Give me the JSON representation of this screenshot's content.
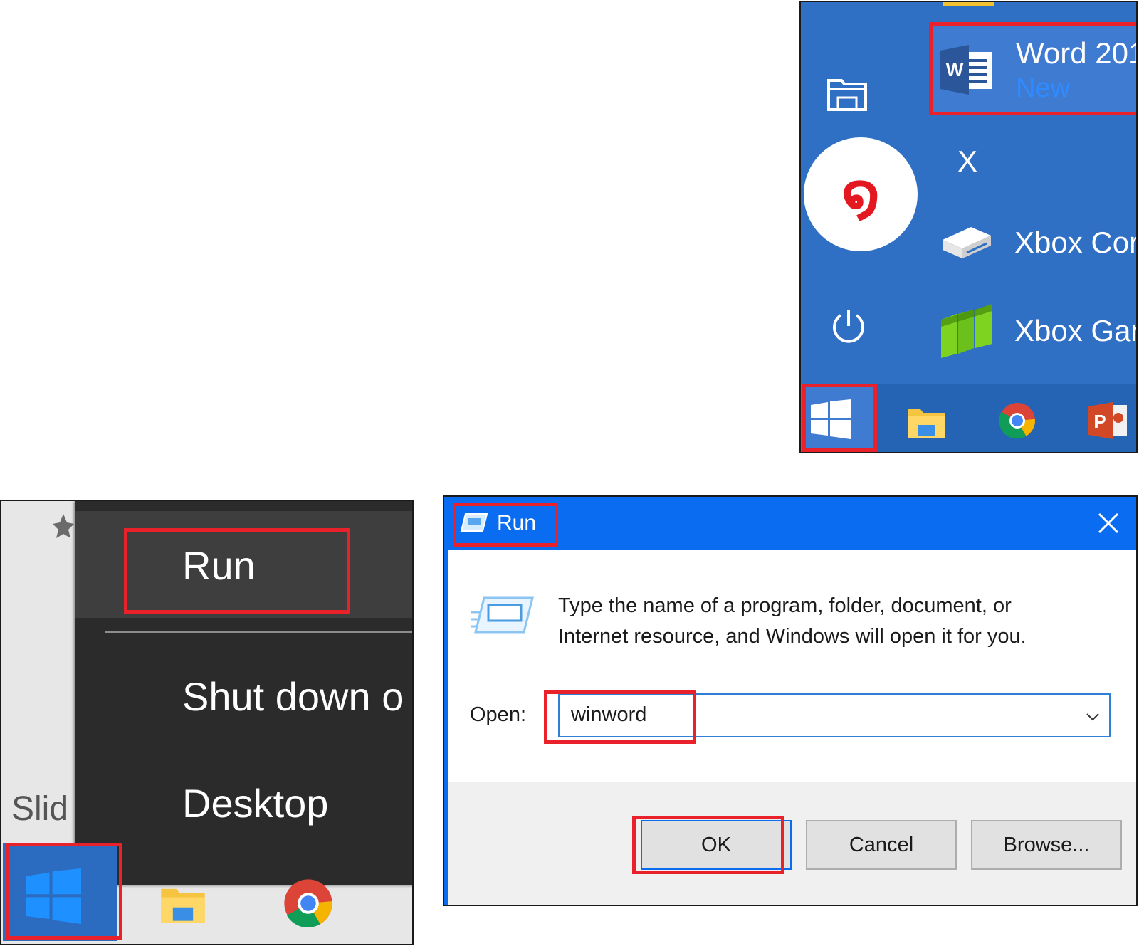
{
  "start_menu": {
    "apps": [
      {
        "label": "Word 201",
        "badge": "New",
        "icon": "word-icon"
      },
      {
        "label": "X",
        "icon": "none"
      },
      {
        "label": "Xbox Cor",
        "icon": "xbox-console-icon"
      },
      {
        "label": "Xbox Gan",
        "icon": "xbox-game-bar-icon"
      }
    ],
    "left_rail_icons": [
      "file-explorer-icon",
      "power-icon"
    ],
    "step_number": "໑",
    "taskbar_icons": [
      "windows-start-icon",
      "file-explorer-icon",
      "chrome-icon",
      "powerpoint-icon"
    ],
    "colors": {
      "menu_bg": "#2f6fc4",
      "highlight": "#e8212b"
    }
  },
  "context_menu": {
    "items": [
      {
        "label": "Run"
      },
      {
        "label": "Shut down o"
      },
      {
        "label": "Desktop"
      }
    ],
    "background_text": "Slid",
    "taskbar_icons": [
      "windows-start-icon",
      "file-explorer-icon",
      "chrome-icon"
    ]
  },
  "run_dialog": {
    "title": "Run",
    "description_line1": "Type the name of a program, folder, document, or",
    "description_line2": "Internet resource, and Windows will open it for you.",
    "open_label": "Open:",
    "open_value": "winword",
    "buttons": {
      "ok": "OK",
      "cancel": "Cancel",
      "browse": "Browse..."
    }
  }
}
